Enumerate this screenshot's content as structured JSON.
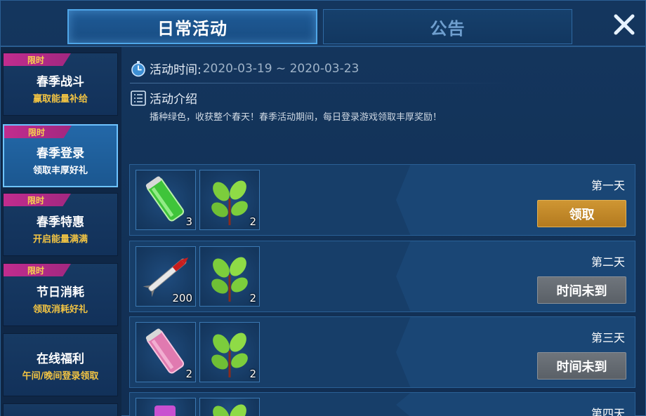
{
  "tabs": {
    "active_label": "日常活动",
    "inactive_label": "公告"
  },
  "sidebar": {
    "items": [
      {
        "badge": "限时",
        "title": "春季战斗",
        "subtitle": "赢取能量补给"
      },
      {
        "badge": "限时",
        "title": "春季登录",
        "subtitle": "领取丰厚好礼"
      },
      {
        "badge": "限时",
        "title": "春季特惠",
        "subtitle": "开启能量满满"
      },
      {
        "badge": "限时",
        "title": "节日消耗",
        "subtitle": "领取消耗好礼"
      },
      {
        "badge": "",
        "title": "在线福利",
        "subtitle": "午间/晚间登录领取"
      }
    ]
  },
  "activity": {
    "time_label": "活动时间:",
    "time_value": "2020-03-19 ~ 2020-03-23",
    "intro_label": "活动介绍",
    "intro_text": "播种绿色，收获整个春天！春季活动期间，每日登录游戏领取丰厚奖励！"
  },
  "rewards": [
    {
      "day": "第一天",
      "button": "领取",
      "state": "claimable",
      "items": [
        {
          "icon": "green-battery-icon",
          "count": "3"
        },
        {
          "icon": "sapling-icon",
          "count": "2"
        }
      ]
    },
    {
      "day": "第二天",
      "button": "时间未到",
      "state": "locked",
      "items": [
        {
          "icon": "red-missile-icon",
          "count": "200"
        },
        {
          "icon": "sapling-icon",
          "count": "2"
        }
      ]
    },
    {
      "day": "第三天",
      "button": "时间未到",
      "state": "locked",
      "items": [
        {
          "icon": "pink-battery-icon",
          "count": "2"
        },
        {
          "icon": "sapling-icon",
          "count": "2"
        }
      ]
    },
    {
      "day": "第四天",
      "button": "",
      "state": "locked",
      "items": [
        {
          "icon": "pink-item-icon",
          "count": ""
        },
        {
          "icon": "sapling-icon",
          "count": ""
        }
      ]
    }
  ],
  "colors": {
    "claim_button": "#c2892a",
    "locked_button": "#656b72",
    "badge": "#c12c8e",
    "subtitle_gold": "#f2c443"
  }
}
